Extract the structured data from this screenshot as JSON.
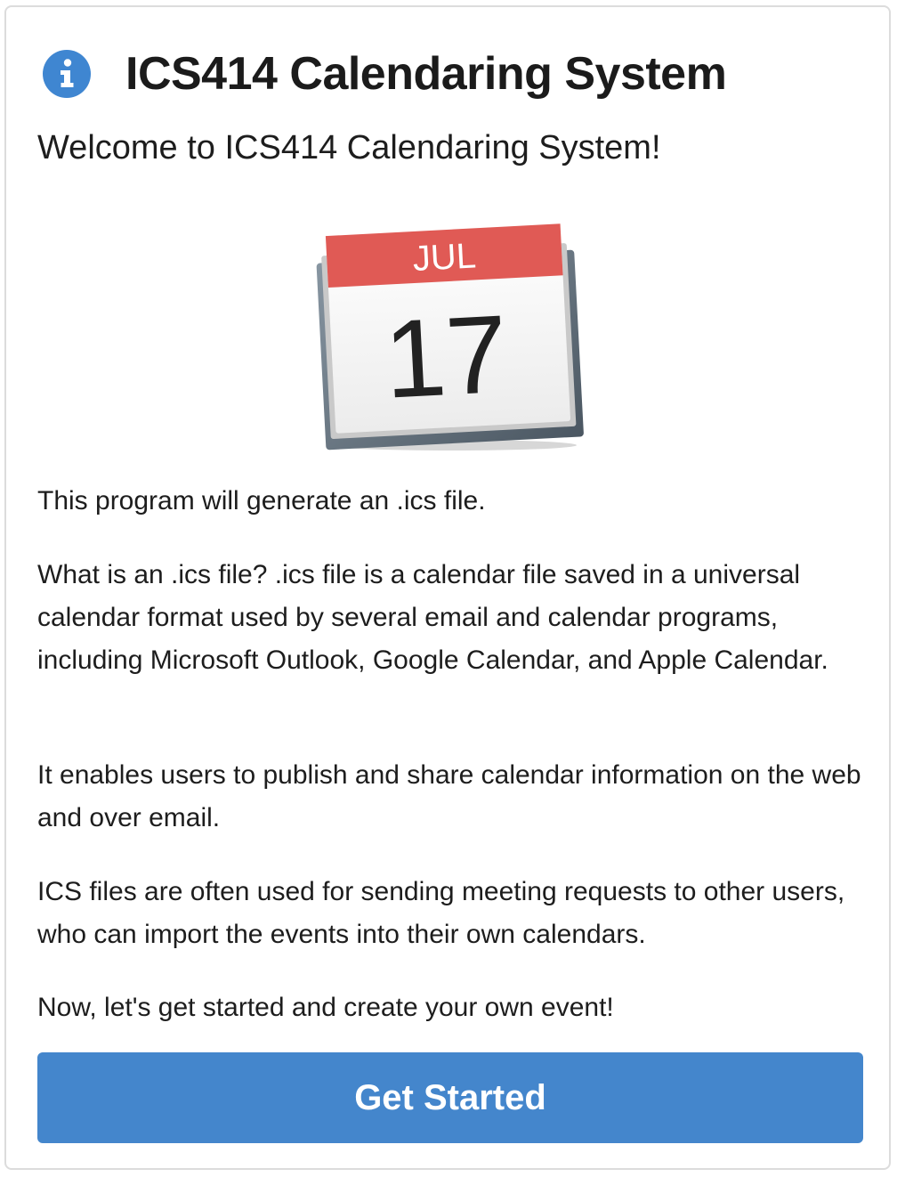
{
  "header": {
    "icon": "info-circle-icon",
    "title": "ICS414 Calendaring System"
  },
  "welcome": "Welcome to ICS414 Calendaring System!",
  "calendar_image": {
    "icon": "calendar-icon",
    "month": "JUL",
    "day": "17"
  },
  "paragraphs": [
    "This program will generate an .ics file.",
    "What is an .ics file? .ics file is a calendar file saved in a universal calendar format used by several email and calendar programs, including Microsoft Outlook, Google Calendar, and Apple Calendar.",
    "It enables users to publish and share calendar information on the web and over email.",
    "ICS files are often used for sending meeting requests to other users, who can import the events into their own calendars.",
    "Now, let's get started and create your own event!"
  ],
  "button": {
    "label": "Get Started"
  },
  "colors": {
    "accent": "#4486cc",
    "calendar_header": "#e05a55",
    "info_icon": "#3f86d1"
  }
}
